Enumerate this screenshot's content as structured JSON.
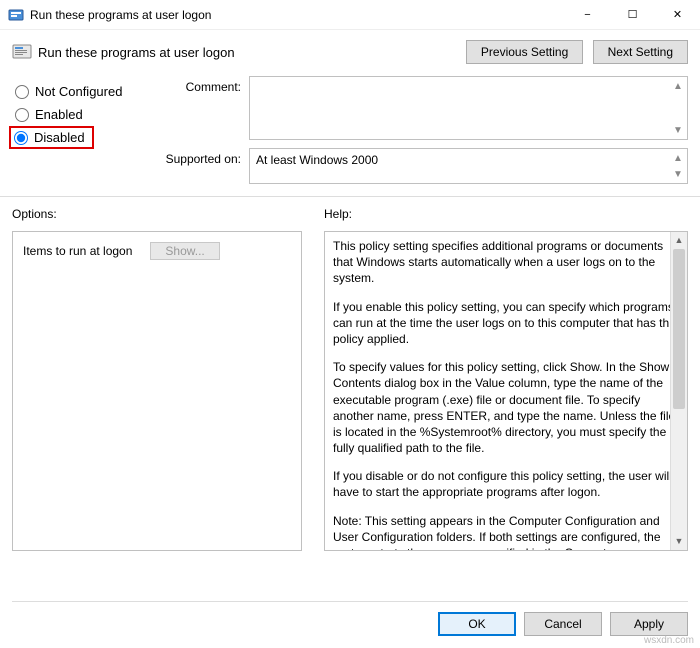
{
  "window": {
    "title": "Run these programs at user logon",
    "minimize": "−",
    "maximize": "☐",
    "close": "✕"
  },
  "header": {
    "title": "Run these programs at user logon",
    "prev": "Previous Setting",
    "next": "Next Setting"
  },
  "radios": {
    "not_configured": "Not Configured",
    "enabled": "Enabled",
    "disabled": "Disabled"
  },
  "labels": {
    "comment": "Comment:",
    "supported": "Supported on:",
    "options": "Options:",
    "help": "Help:"
  },
  "supported_text": "At least Windows 2000",
  "options": {
    "items_label": "Items to run at logon",
    "show": "Show..."
  },
  "help": {
    "p1": "This policy setting specifies additional programs or documents that Windows starts automatically when a user logs on to the system.",
    "p2": "If you enable this policy setting, you can specify which programs can run at the time the user logs on to this computer that has this policy applied.",
    "p3": "To specify values for this policy setting, click Show. In the Show Contents dialog box in the Value column, type the name of the executable program (.exe) file or document file. To specify another name, press ENTER, and type the name. Unless the file is located in the %Systemroot% directory, you must specify the fully qualified path to the file.",
    "p4": "If you disable or do not configure this policy setting, the user will have to start the appropriate programs after logon.",
    "p5": "Note: This setting appears in the Computer Configuration and User Configuration folders. If both settings are configured, the system starts the programs specified in the Computer"
  },
  "footer": {
    "ok": "OK",
    "cancel": "Cancel",
    "apply": "Apply"
  },
  "watermark": "wsxdn.com"
}
